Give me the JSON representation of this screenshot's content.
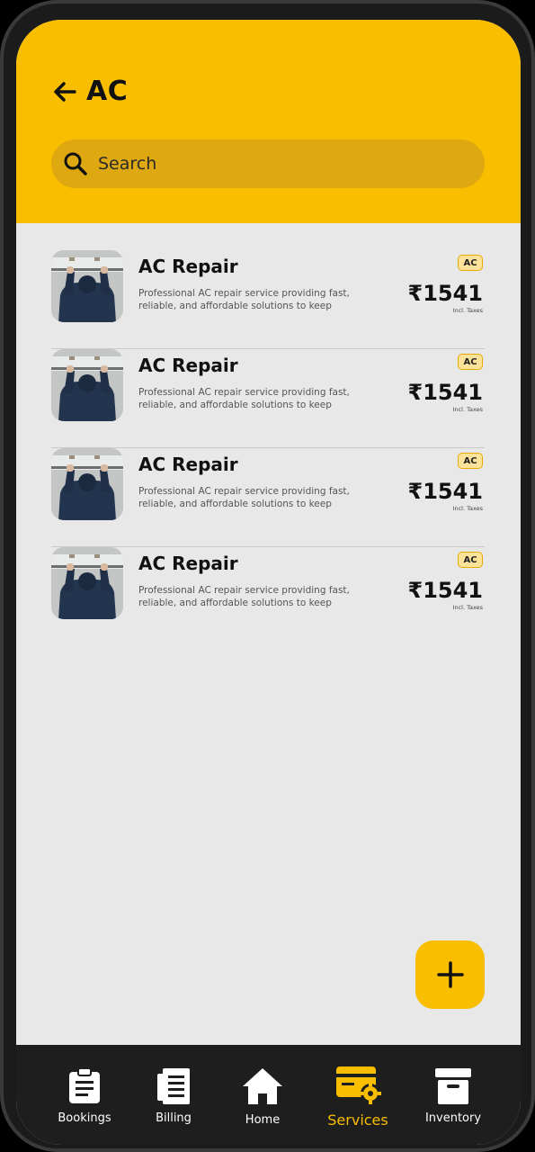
{
  "header": {
    "title": "AC",
    "search_placeholder": "Search"
  },
  "services": [
    {
      "name": "AC Repair",
      "description": "Professional AC repair service providing fast, reliable, and affordable solutions to keep your...",
      "badge": "AC",
      "price": "₹1541",
      "tax_note": "Incl. Taxes"
    },
    {
      "name": "AC Repair",
      "description": "Professional AC repair service providing fast, reliable, and affordable solutions to keep your...",
      "badge": "AC",
      "price": "₹1541",
      "tax_note": "Incl. Taxes"
    },
    {
      "name": "AC Repair",
      "description": "Professional AC repair service providing fast, reliable, and affordable solutions to keep your...",
      "badge": "AC",
      "price": "₹1541",
      "tax_note": "Incl. Taxes"
    },
    {
      "name": "AC Repair",
      "description": "Professional AC repair service providing fast, reliable, and affordable solutions to keep your...",
      "badge": "AC",
      "price": "₹1541",
      "tax_note": "Incl. Taxes"
    }
  ],
  "fab": {
    "icon": "plus-icon"
  },
  "bottom_nav": {
    "items": [
      {
        "label": "Bookings",
        "icon": "clipboard-icon"
      },
      {
        "label": "Billing",
        "icon": "receipt-icon"
      },
      {
        "label": "Home",
        "icon": "home-icon"
      },
      {
        "label": "Services",
        "icon": "service-settings-icon"
      },
      {
        "label": "Inventory",
        "icon": "archive-box-icon"
      }
    ],
    "active": "Services"
  },
  "colors": {
    "accent": "#f9be00",
    "nav_background": "#1e1e1e",
    "content_background": "#e8e8e8"
  }
}
